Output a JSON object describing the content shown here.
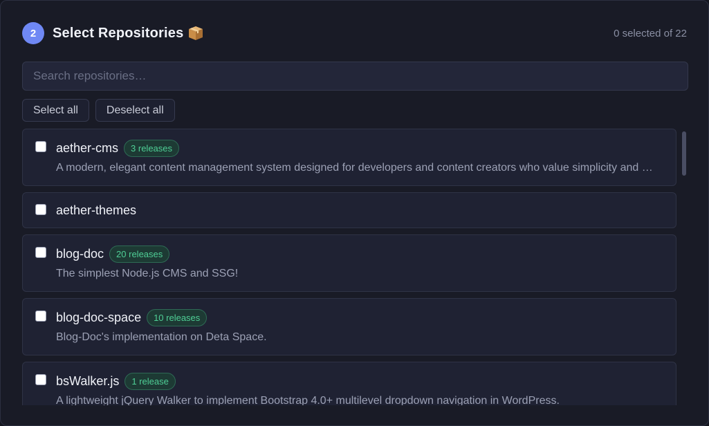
{
  "step": {
    "number": "2",
    "title": "Select Repositories",
    "icon": "package-icon"
  },
  "selection": {
    "count_text": "0 selected of 22"
  },
  "search": {
    "placeholder": "Search repositories…",
    "value": ""
  },
  "buttons": {
    "select_all": "Select all",
    "deselect_all": "Deselect all"
  },
  "repos": [
    {
      "name": "aether-cms",
      "releases": "3 releases",
      "description": "A modern, elegant content management system designed for developers and content creators who value simplicity and performance."
    },
    {
      "name": "aether-themes",
      "releases": "",
      "description": ""
    },
    {
      "name": "blog-doc",
      "releases": "20 releases",
      "description": "The simplest Node.js CMS and SSG!"
    },
    {
      "name": "blog-doc-space",
      "releases": "10 releases",
      "description": "Blog-Doc's implementation on Deta Space."
    },
    {
      "name": "bsWalker.js",
      "releases": "1 release",
      "description": "A lightweight jQuery Walker to implement Bootstrap 4.0+ multilevel dropdown navigation in WordPress."
    }
  ],
  "colors": {
    "accent": "#6f88f4",
    "badge_text": "#4fcf96",
    "background": "#191b26"
  }
}
